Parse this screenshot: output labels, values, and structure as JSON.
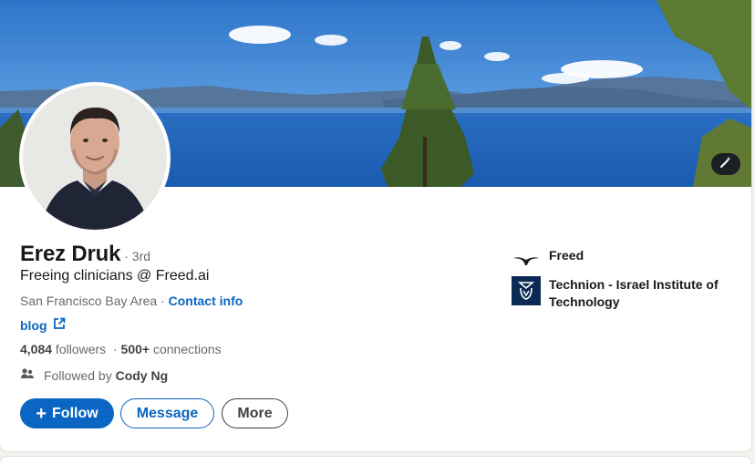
{
  "profile": {
    "name": "Erez Druk",
    "degree": "· 3rd",
    "headline": "Freeing clinicians @ Freed.ai",
    "location": "San Francisco Bay Area · ",
    "contact_link": "Contact info",
    "blog_link": "blog",
    "followers": "4,084",
    "followers_label": " followers",
    "connections_sep": "  · ",
    "connections": "500+",
    "connections_label": " connections",
    "followed_by_prefix": "Followed by ",
    "followed_by_name": "Cody Ng"
  },
  "actions": {
    "follow": "Follow",
    "follow_icon": "+",
    "message": "Message",
    "more": "More"
  },
  "experience": [
    {
      "label": "Freed",
      "icon": "freed-logo-icon"
    },
    {
      "label": "Technion - Israel Institute of Technology",
      "icon": "technion-logo-icon"
    }
  ],
  "colors": {
    "accent": "#0a66c2",
    "card": "#ffffff",
    "page_bg": "#f4f2ee"
  }
}
